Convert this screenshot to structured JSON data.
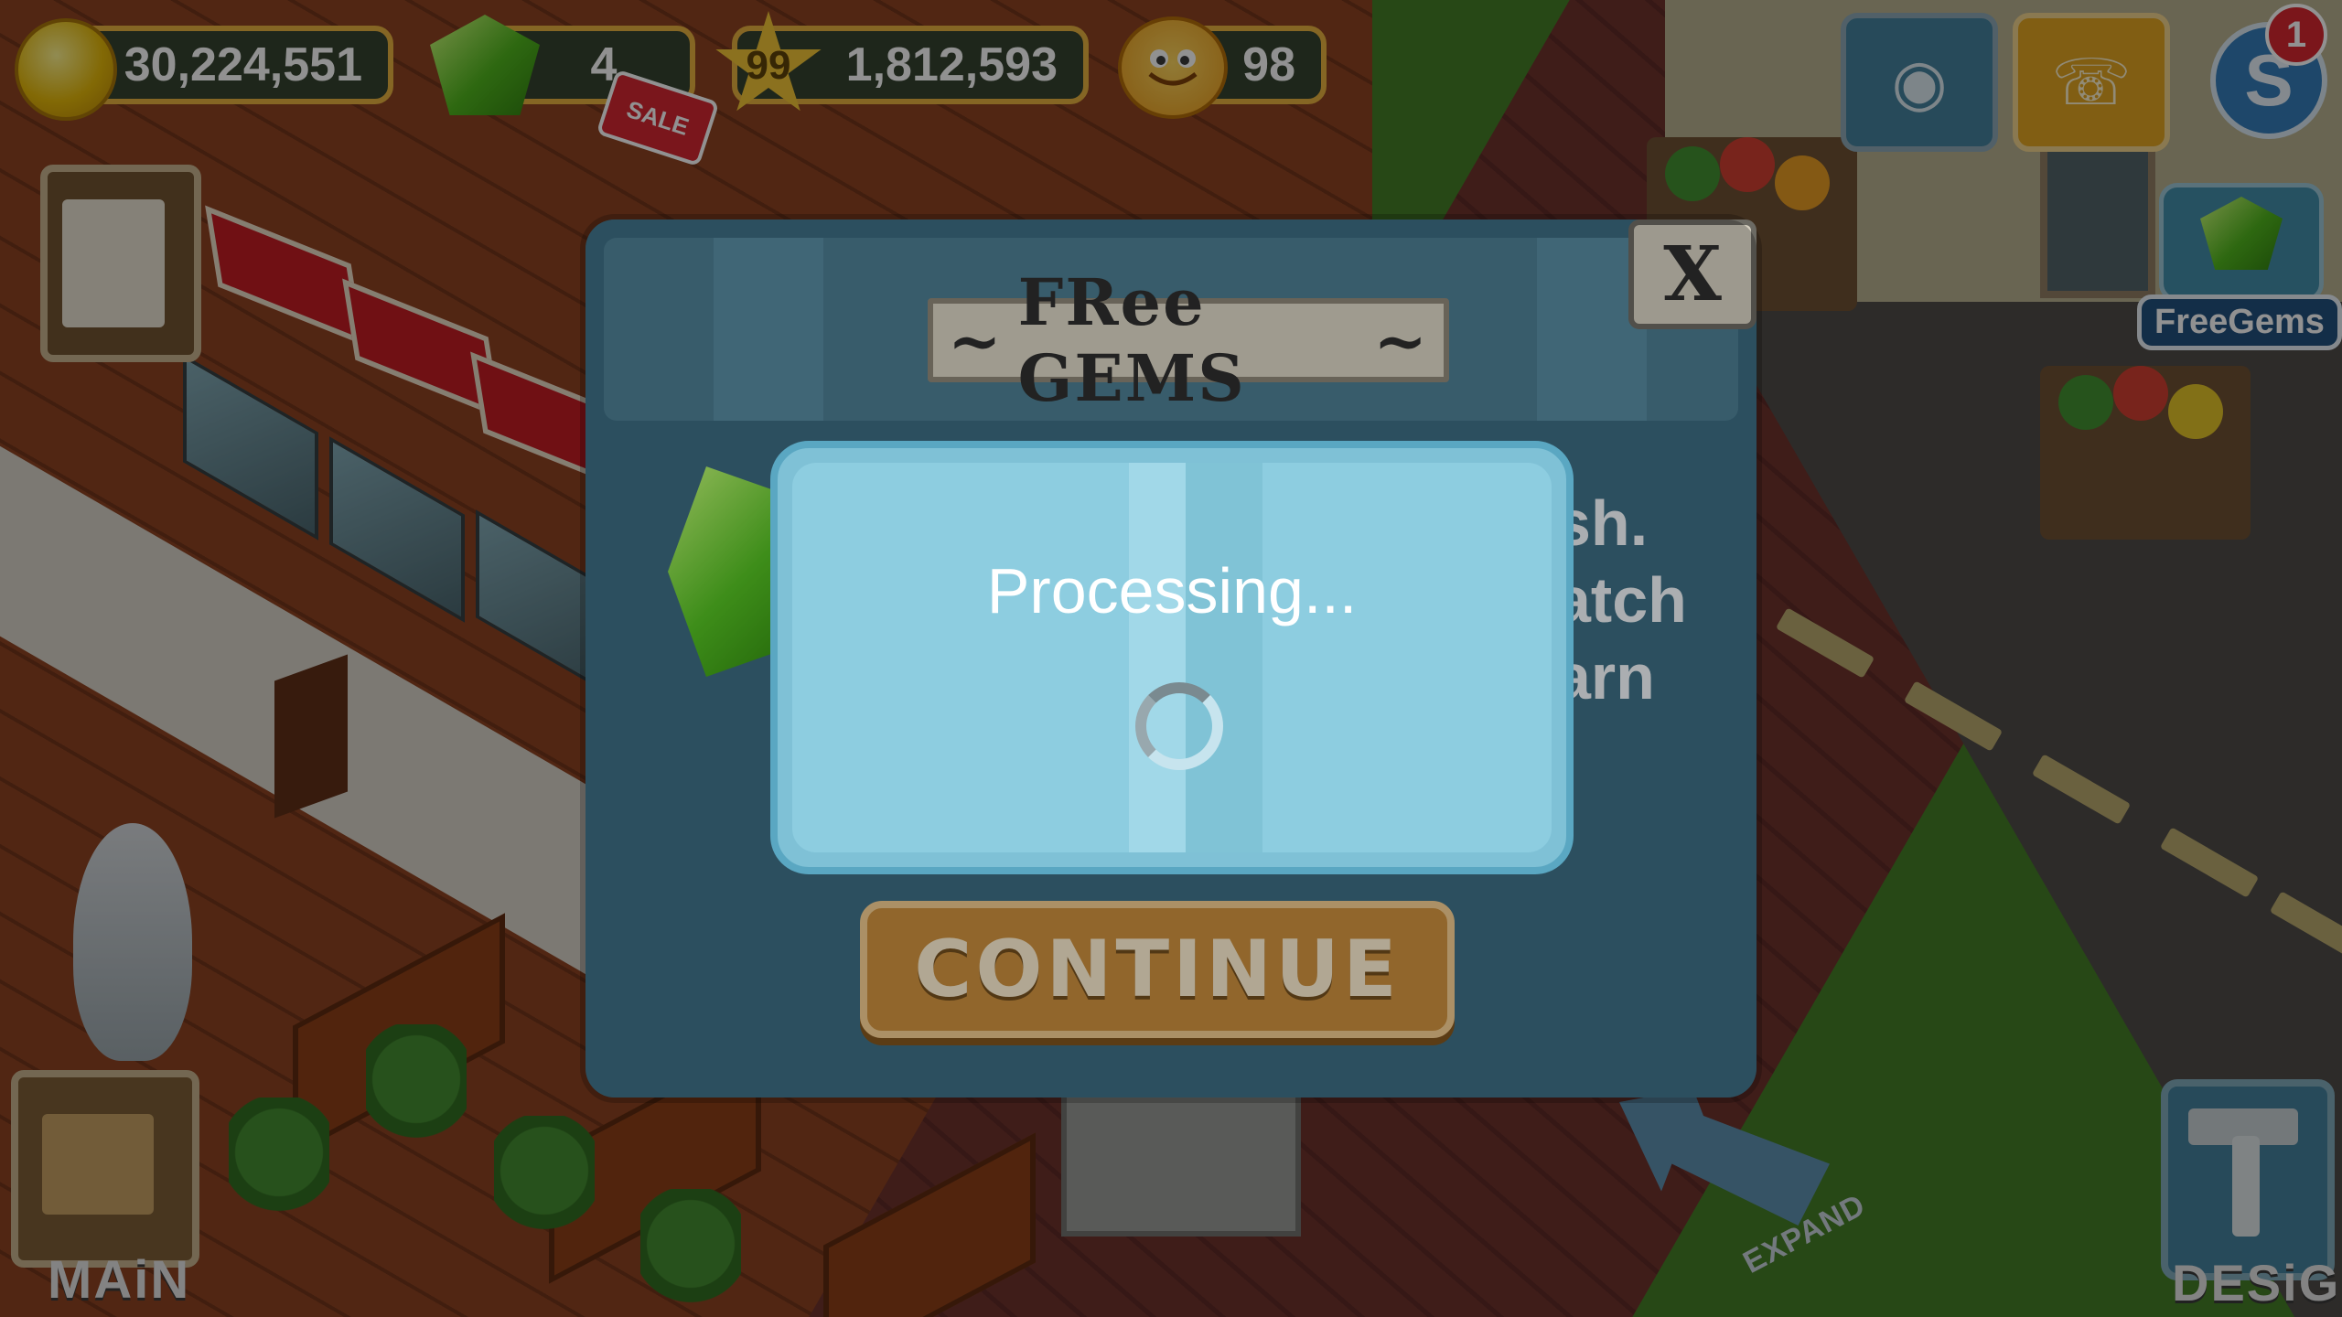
{
  "hud": {
    "coins": "30,224,551",
    "gems": "4",
    "sale_label": "SALE",
    "level": "99",
    "experience": "1,812,593",
    "happiness": "98",
    "notification_count": "1",
    "freegems_label": "FreeGems"
  },
  "bottom_bar": {
    "main_label": "MAiN",
    "design_label": "DESiGN",
    "expand_label": "EXPAND"
  },
  "dialog": {
    "title": "FRee GEMS",
    "close_label": "X",
    "body_fragments": [
      "sh.",
      "atch",
      "arn"
    ],
    "continue_label": "CONTINUE"
  },
  "processing": {
    "label": "Processing..."
  },
  "colors": {
    "dialog_bg": "#3a6a80",
    "processing_bg": "#8dcde0",
    "continue_bg": "#c58a39",
    "hud_border": "#e9b13a"
  },
  "icons": [
    "coin-icon",
    "gem-icon",
    "star-icon",
    "smiley-icon",
    "camera-icon",
    "telephone-icon",
    "social-icon",
    "freegems-tv-icon",
    "clipboard-icon",
    "hammer-icon",
    "expand-arrow-icon"
  ]
}
